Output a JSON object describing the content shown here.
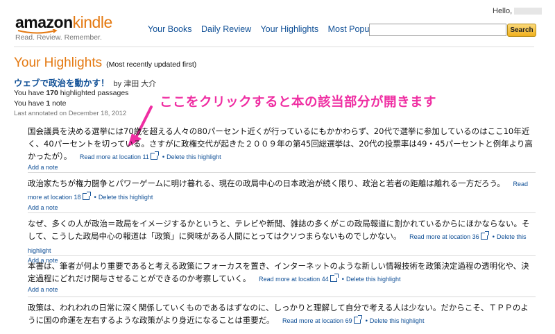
{
  "header": {
    "logo_amazon": "amazon",
    "logo_kindle": "kindle",
    "logo_tagline": "Read. Review. Remember.",
    "greeting": "Hello,",
    "search_button": "Search",
    "search_value": ""
  },
  "nav": {
    "items": [
      "Your Books",
      "Daily Review",
      "Your Highlights",
      "Most Popular"
    ]
  },
  "page": {
    "title": "Your Highlights",
    "subtitle": "(Most recently updated first)"
  },
  "book": {
    "title": "ウェブで政治を動かす！",
    "author": "by 津田 大介",
    "passages_pre": "You have ",
    "passages_count": "170",
    "passages_post": " highlighted passages",
    "notes_pre": "You have ",
    "notes_count": "1",
    "notes_post": " note",
    "last_annotated": "Last annotated on December 18, 2012"
  },
  "callout": "ここをクリックすると本の該当部分が開きます",
  "highlight_delete": "Delete this highlight",
  "highlight_add_note": "Add a note",
  "highlights": [
    {
      "text": "国会議員を決める選挙には70歳を超える人々の80パーセント近くが行っているにもかかわらず、20代で選挙に参加しているのはここ10年近く、40パーセントを切っている。さすがに政権交代が起きた２００９年の第45回総選挙は、20代の投票率は49・45パーセントと例年より高かったが）。",
      "location": "Read more at location 11"
    },
    {
      "text": "政治家たちが権力闘争とパワーゲームに明け暮れる、現在の政局中心の日本政治が続く限り、政治と若者の距離は離れる一方だろう。",
      "location": "Read more at location 18"
    },
    {
      "text": "なぜ、多くの人が政治＝政局をイメージするかというと、テレビや新聞、雑誌の多くがこの政局報道に割かれているからにほかならない。そして、こうした政局中心の報道は「政策」に興味がある人間にとってはクソつまらないものでしかない。",
      "location": "Read more at location 36"
    },
    {
      "text": "本書は、筆者が何より重要であると考える政策にフォーカスを置き、インターネットのような新しい情報技術を政策決定過程の透明化や、決定過程にどれだけ関与させることができるのか考察していく。",
      "location": "Read more at location 44"
    },
    {
      "text": "政策は、われわれの日常に深く関係していくものであるはずなのに、しっかりと理解して自分で考える人は少ない。だからこそ、ＴＰＰのように国の命運を左右するような政策がより身近になることは重要だ。",
      "location": "Read more at location 69"
    }
  ],
  "colors": {
    "accent": "#e47911",
    "link": "#0f4f96",
    "callout": "#ef2ea2"
  }
}
